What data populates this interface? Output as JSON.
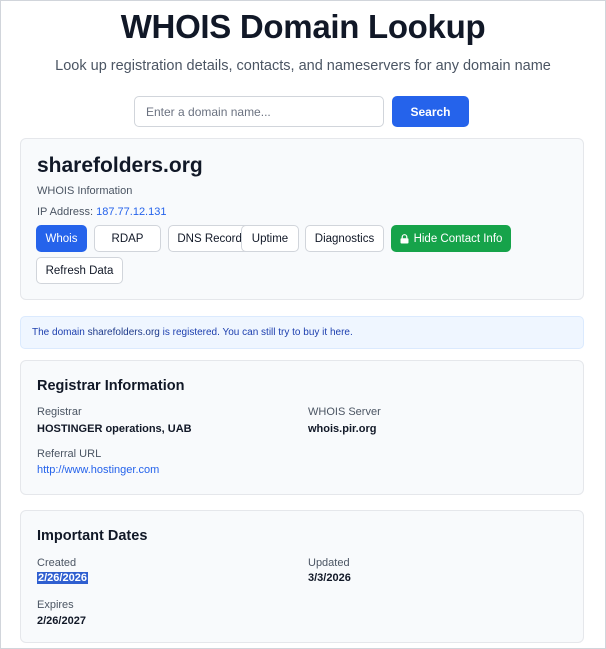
{
  "header": {
    "title": "WHOIS Domain Lookup",
    "subtitle": "Look up registration details, contacts, and nameservers for any domain name"
  },
  "search": {
    "placeholder": "Enter a domain name...",
    "value": "",
    "button_label": "Search"
  },
  "domain": {
    "name": "sharefolders.org",
    "info_label": "WHOIS Information",
    "ip_label": "IP Address:",
    "ip_value": "187.77.12.131"
  },
  "tabs": [
    {
      "label": "Whois",
      "active": true
    },
    {
      "label": "RDAP"
    },
    {
      "label": "DNS Records"
    },
    {
      "label": "Uptime"
    },
    {
      "label": "Diagnostics"
    },
    {
      "label": "Hide Contact Info",
      "icon": "lock-icon"
    },
    {
      "label": "Refresh Data"
    }
  ],
  "notice": {
    "prefix": "The domain",
    "domain": "sharefolders.org",
    "suffix": "is registered. You can still try to buy it here."
  },
  "registrar": {
    "heading": "Registrar Information",
    "registrar_label": "Registrar",
    "registrar_value": "HOSTINGER operations, UAB",
    "whois_server_label": "WHOIS Server",
    "whois_server_value": "whois.pir.org",
    "referral_label": "Referral URL",
    "referral_value": "http://www.hostinger.com"
  },
  "dates": {
    "heading": "Important Dates",
    "created_label": "Created",
    "created_value": "2/26/2026",
    "updated_label": "Updated",
    "updated_value": "3/3/2026",
    "expires_label": "Expires",
    "expires_value": "2/26/2027"
  },
  "colors": {
    "primary": "#2563eb",
    "success": "#16a34a",
    "notice_bg": "#eff6ff",
    "card_bg": "#f8fafc"
  }
}
